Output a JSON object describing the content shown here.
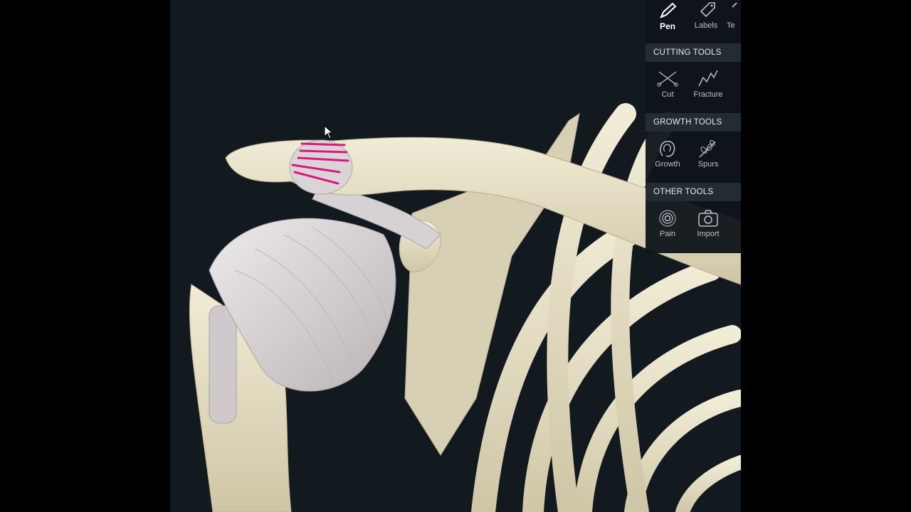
{
  "toolbar": {
    "top_tools": [
      {
        "label": "Pen",
        "icon": "pen-icon",
        "active": true
      },
      {
        "label": "Labels",
        "icon": "tag-icon"
      },
      {
        "label": "Te",
        "icon": "text-icon"
      }
    ],
    "sections": [
      {
        "title": "CUTTING TOOLS",
        "tools": [
          {
            "label": "Cut",
            "icon": "scissors-icon"
          },
          {
            "label": "Fracture",
            "icon": "fracture-icon"
          }
        ]
      },
      {
        "title": "GROWTH TOOLS",
        "tools": [
          {
            "label": "Growth",
            "icon": "growth-icon"
          },
          {
            "label": "Spurs",
            "icon": "spurs-icon"
          }
        ]
      },
      {
        "title": "OTHER TOOLS",
        "tools": [
          {
            "label": "Pain",
            "icon": "pain-icon"
          },
          {
            "label": "Import",
            "icon": "camera-icon"
          }
        ]
      }
    ]
  },
  "colors": {
    "background": "#131a1f",
    "bone": "#e7e1c9",
    "muscle": "#d9d5d6",
    "annotation": "#e0157f",
    "panel": "#0e1419",
    "section_header": "#242c33"
  }
}
